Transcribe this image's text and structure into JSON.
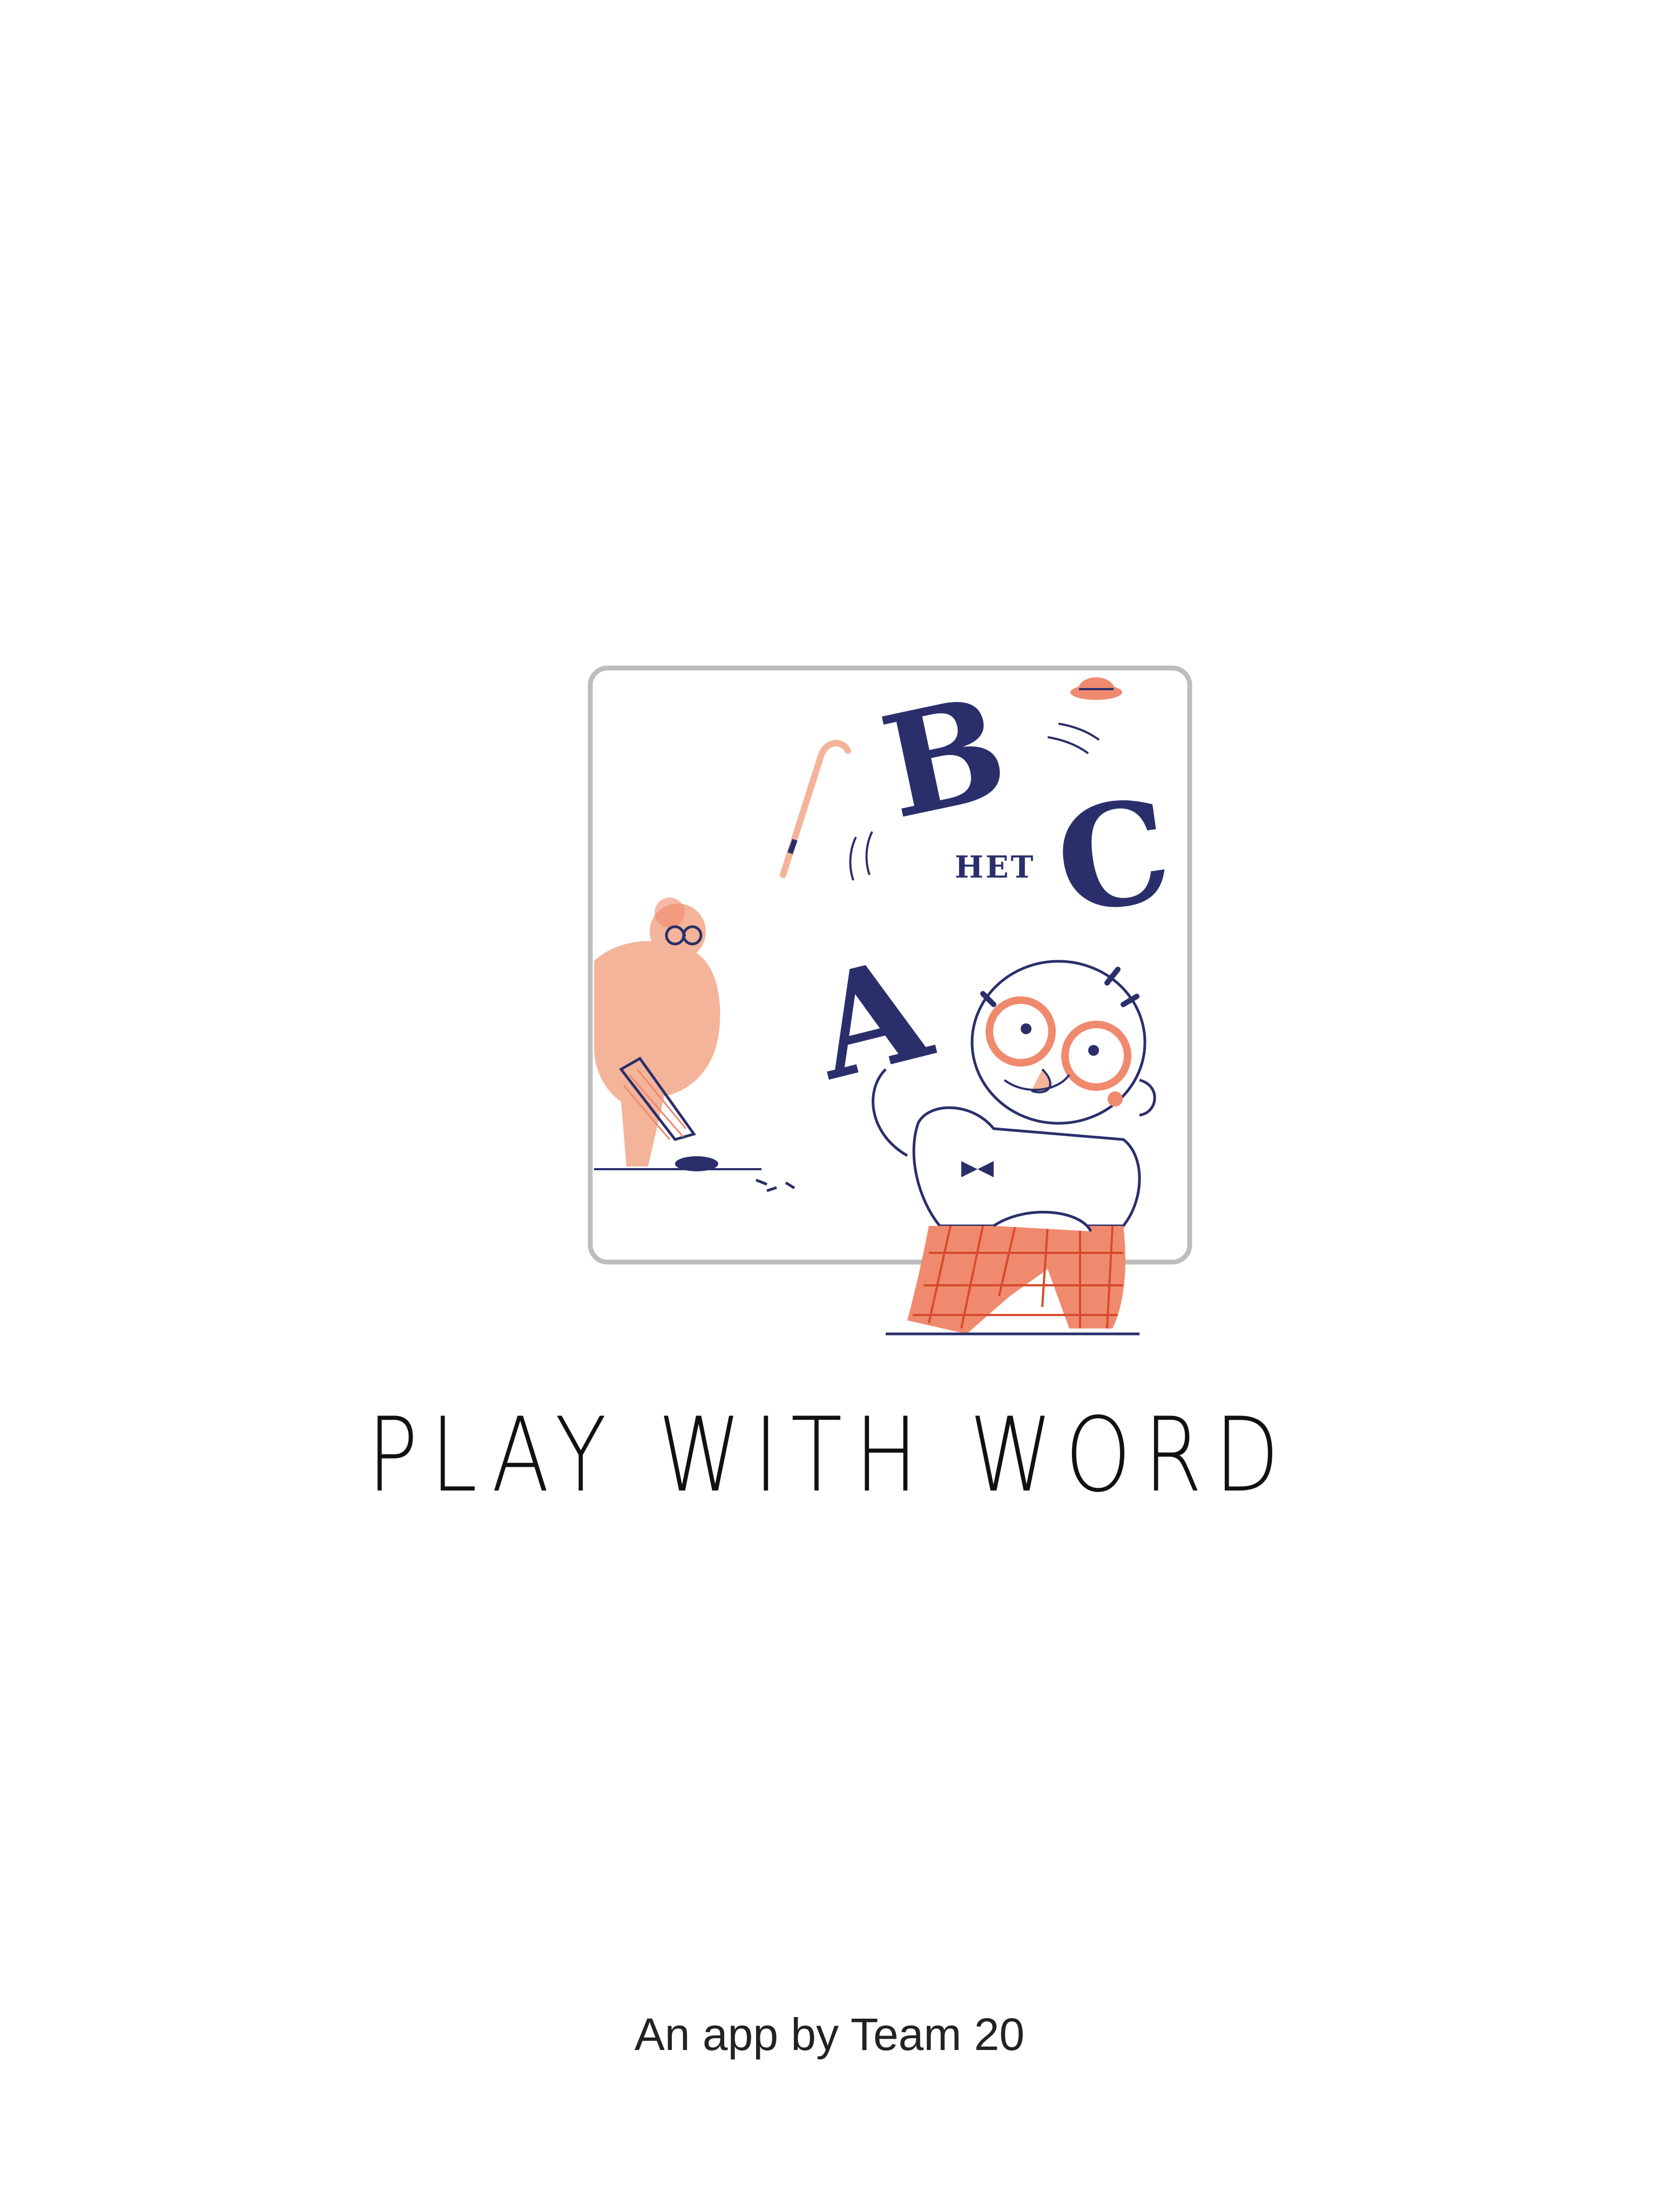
{
  "splash": {
    "title": "PLAY WITH WORD",
    "credit": "An app by Team 20",
    "illustration": {
      "letters": [
        "A",
        "B",
        "C"
      ],
      "label": "HET"
    }
  },
  "colors": {
    "background": "#ffffff",
    "frame_border": "#bdbdbd",
    "navy": "#2a2f6b",
    "coral": "#f08a6e",
    "peach": "#f4b49a",
    "text": "#111111"
  },
  "icons": {
    "letter_a": "letter-a-icon",
    "letter_b": "letter-b-icon",
    "letter_c": "letter-c-icon",
    "cane": "cane-icon",
    "hat": "bowler-hat-icon"
  }
}
